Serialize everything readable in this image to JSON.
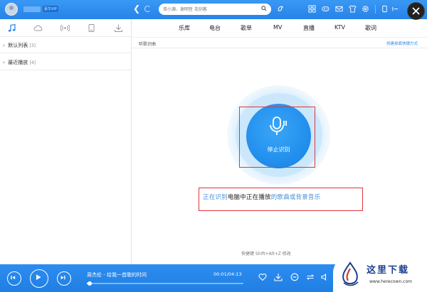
{
  "window": {
    "vip_badge": "豪华VIP"
  },
  "search": {
    "placeholder": "单小源、谢明哲 花剑客"
  },
  "sidebar": {
    "tabs": [
      {
        "icon": "music-note-icon"
      },
      {
        "icon": "cloud-icon"
      },
      {
        "icon": "radio-icon"
      },
      {
        "icon": "device-icon"
      },
      {
        "icon": "download-icon"
      }
    ],
    "playlists": [
      {
        "label": "默认列表",
        "count": "[3]"
      },
      {
        "label": "最近播放",
        "count": "[4]"
      }
    ]
  },
  "nav": {
    "tabs": [
      "乐库",
      "电台",
      "歌单",
      "MV",
      "直播",
      "KTV",
      "歌词"
    ]
  },
  "page": {
    "title": "听歌识曲",
    "shortcut_link": "创建桌面快捷方式",
    "stop_button": "停止识别",
    "status_part1": "正在识别",
    "status_part2": "电脑中正在播放",
    "status_part3": "的歌曲或背景音乐",
    "hotkey": "快捷键  Shift+Alt+Z  修改"
  },
  "player": {
    "track": "周杰伦 - 给我一首歌的时间",
    "time": "00:01/04:13",
    "progress_fraction": 0.004
  },
  "watermark": {
    "name": "这里下载",
    "url": "www.herecown.com"
  },
  "colors": {
    "accent": "#2d8cf0",
    "highlight_box": "#e0363b"
  }
}
